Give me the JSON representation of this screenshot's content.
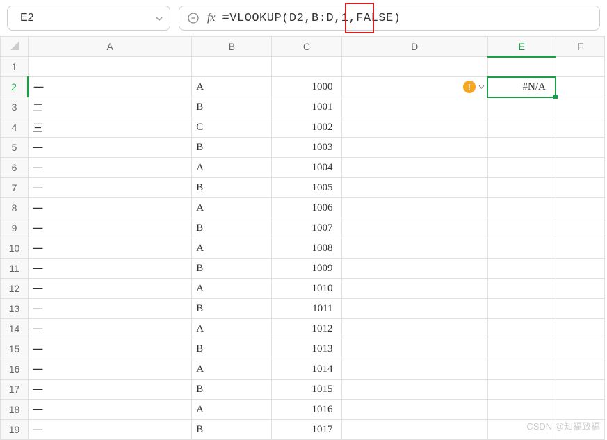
{
  "name_box": {
    "value": "E2"
  },
  "formula_bar": {
    "fx_label": "fx",
    "formula": "=VLOOKUP(D2,B:D,1,FALSE)"
  },
  "columns": [
    "A",
    "B",
    "C",
    "D",
    "E",
    "F"
  ],
  "active_cell": {
    "row": 2,
    "col": "E",
    "value": "#N/A"
  },
  "error_indicator": {
    "symbol": "!",
    "present_row": 2
  },
  "rows": [
    {
      "n": 1,
      "a": "",
      "b": "",
      "c": "",
      "d": "",
      "e": ""
    },
    {
      "n": 2,
      "a": "一",
      "b": "A",
      "c": "1000",
      "d": "",
      "e": "#N/A"
    },
    {
      "n": 3,
      "a": "二",
      "b": "B",
      "c": "1001",
      "d": "",
      "e": ""
    },
    {
      "n": 4,
      "a": "三",
      "b": "C",
      "c": "1002",
      "d": "",
      "e": ""
    },
    {
      "n": 5,
      "a": "一",
      "b": "B",
      "c": "1003",
      "d": "",
      "e": ""
    },
    {
      "n": 6,
      "a": "一",
      "b": "A",
      "c": "1004",
      "d": "",
      "e": ""
    },
    {
      "n": 7,
      "a": "一",
      "b": "B",
      "c": "1005",
      "d": "",
      "e": ""
    },
    {
      "n": 8,
      "a": "一",
      "b": "A",
      "c": "1006",
      "d": "",
      "e": ""
    },
    {
      "n": 9,
      "a": "一",
      "b": "B",
      "c": "1007",
      "d": "",
      "e": ""
    },
    {
      "n": 10,
      "a": "一",
      "b": "A",
      "c": "1008",
      "d": "",
      "e": ""
    },
    {
      "n": 11,
      "a": "一",
      "b": "B",
      "c": "1009",
      "d": "",
      "e": ""
    },
    {
      "n": 12,
      "a": "一",
      "b": "A",
      "c": "1010",
      "d": "",
      "e": ""
    },
    {
      "n": 13,
      "a": "一",
      "b": "B",
      "c": "1011",
      "d": "",
      "e": ""
    },
    {
      "n": 14,
      "a": "一",
      "b": "A",
      "c": "1012",
      "d": "",
      "e": ""
    },
    {
      "n": 15,
      "a": "一",
      "b": "B",
      "c": "1013",
      "d": "",
      "e": ""
    },
    {
      "n": 16,
      "a": "一",
      "b": "A",
      "c": "1014",
      "d": "",
      "e": ""
    },
    {
      "n": 17,
      "a": "一",
      "b": "B",
      "c": "1015",
      "d": "",
      "e": ""
    },
    {
      "n": 18,
      "a": "一",
      "b": "A",
      "c": "1016",
      "d": "",
      "e": ""
    },
    {
      "n": 19,
      "a": "一",
      "b": "B",
      "c": "1017",
      "d": "",
      "e": ""
    }
  ],
  "watermark": "CSDN @知福致福"
}
